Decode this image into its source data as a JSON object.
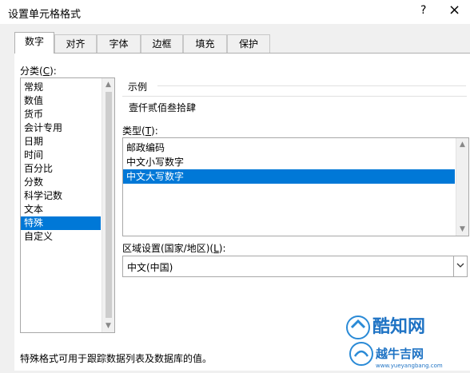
{
  "window": {
    "title": "设置单元格格式",
    "help": "?",
    "close": "×"
  },
  "tabs": [
    {
      "label": "数字",
      "active": true
    },
    {
      "label": "对齐"
    },
    {
      "label": "字体"
    },
    {
      "label": "边框"
    },
    {
      "label": "填充"
    },
    {
      "label": "保护"
    }
  ],
  "category": {
    "label": "分类",
    "hotkey": "C",
    "items": [
      "常规",
      "数值",
      "货币",
      "会计专用",
      "日期",
      "时间",
      "百分比",
      "分数",
      "科学记数",
      "文本",
      "特殊",
      "自定义"
    ],
    "selected": "特殊"
  },
  "sample": {
    "label": "示例",
    "value": "壹仟贰佰叁拾肆"
  },
  "type": {
    "label": "类型",
    "hotkey": "T",
    "items": [
      "邮政编码",
      "中文小写数字",
      "中文大写数字"
    ],
    "selected": "中文大写数字"
  },
  "locale": {
    "label": "区域设置(国家/地区)",
    "hotkey": "L",
    "value": "中文(中国)"
  },
  "description": "特殊格式可用于跟踪数据列表及数据库的值。",
  "watermark": {
    "logo_text": "酷知网",
    "sub_text": "越牛吉网",
    "url": "www.yueyangbang.com"
  },
  "colors": {
    "selection": "#0078d7",
    "panel": "#ffffff",
    "dialog": "#f0f0f0"
  }
}
